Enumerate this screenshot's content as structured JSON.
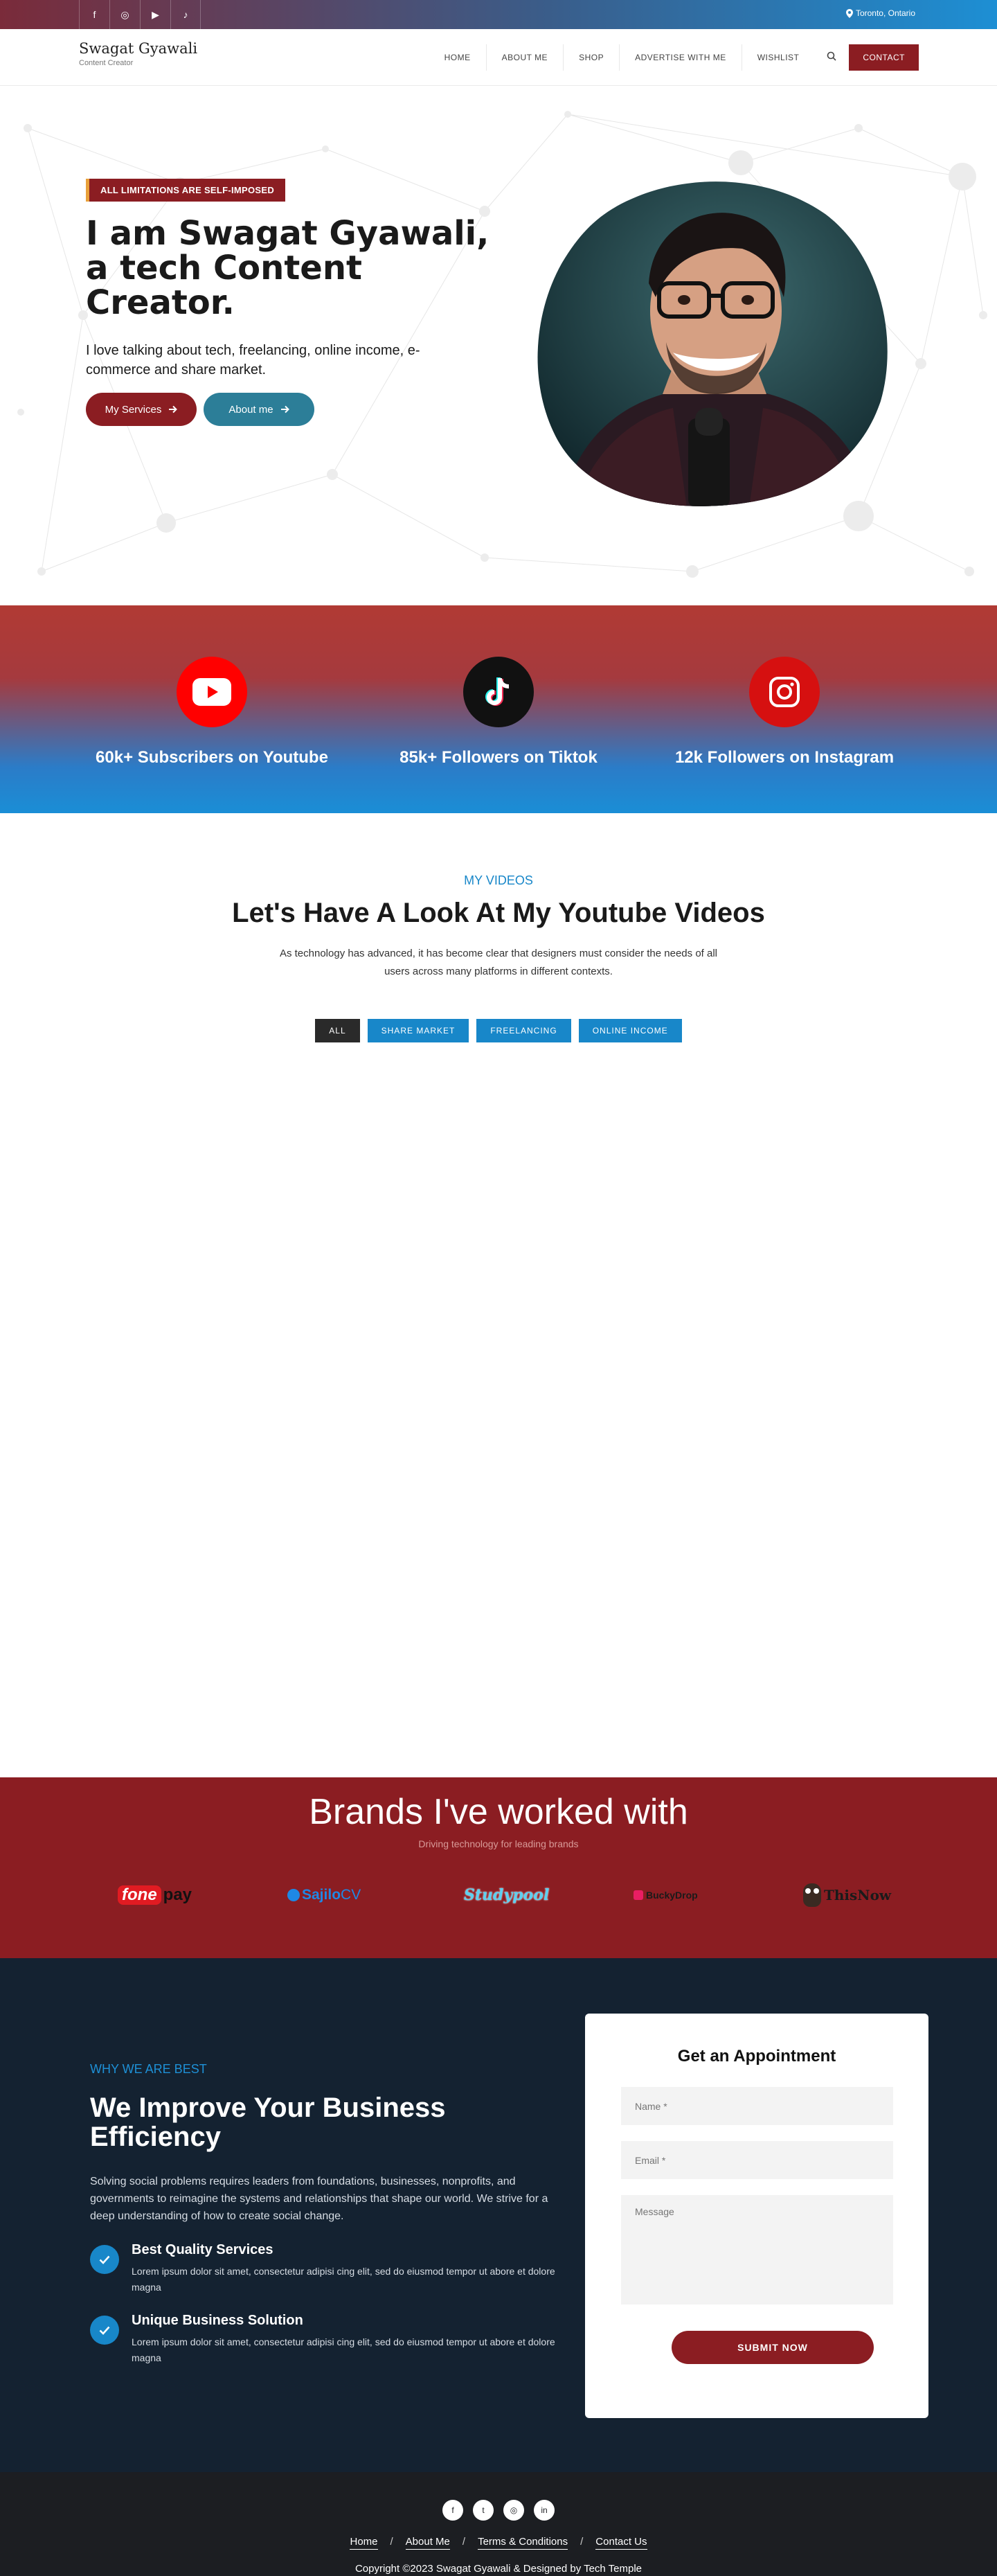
{
  "topbar": {
    "socials": [
      {
        "icon": "facebook-icon",
        "glyph": "f"
      },
      {
        "icon": "instagram-icon",
        "glyph": "◎"
      },
      {
        "icon": "youtube-icon",
        "glyph": "▶"
      },
      {
        "icon": "tiktok-icon",
        "glyph": "♪"
      }
    ],
    "location_icon": "map-pin-icon",
    "location": "Toronto, Ontario"
  },
  "header": {
    "brand_name": "Swagat Gyawali",
    "brand_tagline": "Content Creator",
    "nav": [
      "HOME",
      "ABOUT ME",
      "SHOP",
      "ADVERTISE WITH ME",
      "WISHLIST"
    ],
    "search_icon": "search-icon",
    "contact_label": "CONTACT"
  },
  "hero": {
    "badge": "ALL LIMITATIONS ARE SELF-IMPOSED",
    "headline": "I am Swagat Gyawali, a tech Content Creator.",
    "subtext": "I love talking about tech, freelancing, online income, e-commerce and share market.",
    "btn_services": "My Services",
    "btn_about": "About me",
    "arrow_icon": "arrow-right-icon"
  },
  "stats": [
    {
      "icon": "youtube-icon",
      "label": "60k+ Subscribers on Youtube",
      "color": "#ff0000"
    },
    {
      "icon": "tiktok-icon",
      "label": "85k+ Followers on Tiktok",
      "color": "#111111"
    },
    {
      "icon": "instagram-icon",
      "label": "12k Followers on Instagram",
      "color": "#d61010"
    }
  ],
  "videos": {
    "eyebrow": "MY VIDEOS",
    "title": "Let's Have A Look At My Youtube Videos",
    "description": "As technology has advanced, it has become clear that designers must consider the needs of all users across many platforms in different contexts.",
    "filters": [
      "ALL",
      "SHARE MARKET",
      "FREELANCING",
      "ONLINE INCOME"
    ],
    "active_filter": "ALL"
  },
  "brands": {
    "title": "Brands I've worked with",
    "subtitle": "Driving technology for leading brands",
    "logos": [
      {
        "text_a": "fone",
        "text_b": "pay"
      },
      {
        "text_a": "Sajilo",
        "text_b": "CV"
      },
      {
        "text_a": "Studypool",
        "text_b": ""
      },
      {
        "text_a": "BuckyDrop",
        "text_b": ""
      },
      {
        "text_a": "This",
        "text_b": "Now"
      }
    ]
  },
  "business": {
    "eyebrow": "WHY WE ARE BEST",
    "title": "We Improve Your Business Efficiency",
    "intro": "Solving social problems requires leaders from foundations, businesses, nonprofits, and governments to reimagine the systems and relationships that shape our world. We strive for a deep understanding of how to create social change.",
    "features": [
      {
        "title": "Best Quality Services",
        "text": "Lorem ipsum dolor sit amet, consectetur adipisi cing elit, sed do eiusmod tempor ut abore et dolore magna"
      },
      {
        "title": "Unique Business Solution",
        "text": "Lorem ipsum dolor sit amet, consectetur adipisi cing elit, sed do eiusmod tempor ut abore et dolore magna"
      }
    ],
    "check_icon": "check-icon"
  },
  "form": {
    "title": "Get an Appointment",
    "name_placeholder": "Name *",
    "email_placeholder": "Email *",
    "message_placeholder": "Message",
    "submit": "SUBMIT NOW"
  },
  "footer": {
    "socials": [
      "facebook-icon",
      "twitter-icon",
      "instagram-icon",
      "linkedin-icon"
    ],
    "social_glyphs": [
      "f",
      "t",
      "◎",
      "in"
    ],
    "links": [
      "Home",
      "About Me",
      "Terms & Conditions",
      "Contact Us"
    ],
    "separator": "/",
    "copyright": "Copyright ©2023 Swagat Gyawali & Designed by Tech Temple"
  }
}
